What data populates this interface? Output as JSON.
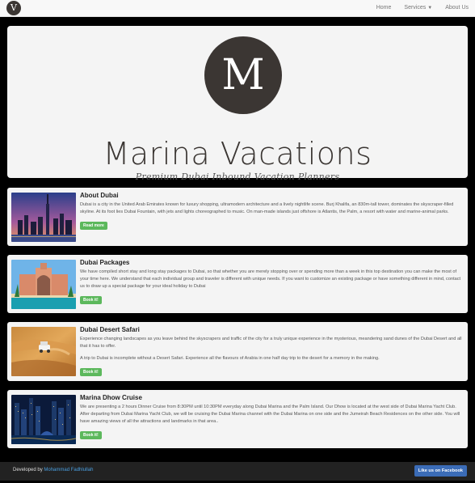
{
  "navbar": {
    "logo_letter": "V",
    "links": [
      {
        "label": "Home"
      },
      {
        "label": "Services",
        "dropdown": true
      },
      {
        "label": "About Us"
      }
    ]
  },
  "hero": {
    "logo_letter": "M",
    "title": "Marina Vacations",
    "subtitle": "Premium Dubai Inbound Vacation Planners"
  },
  "cards": [
    {
      "title": "About Dubai",
      "text": "Dubai is a city in the United Arab Emirates known for luxury shopping, ultramodern architecture and a lively nightlife scene. Burj Khalifa, an 830m-tall tower, dominates the skyscraper-filled skyline. At its foot lies Dubai Fountain, with jets and lights choreographed to music. On man-made islands just offshore is Atlantis, the Palm, a resort with water and marine-animal parks.",
      "text2": "",
      "button": "Read more"
    },
    {
      "title": "Dubai Packages",
      "text": "We have compiled short stay and long stay packages to Dubai, so that whether you are merely stopping over or spending more than a week in this top destination you can make the most of your time here. We understand that each individual group and traveler is different with unique needs. If you want to customize an existing package or have something different in mind, contact us to draw up a special package for your ideal holiday to Dubai",
      "text2": "",
      "button": "Book it!"
    },
    {
      "title": "Dubai Desert Safari",
      "text": "Experience changing landscapes as you leave behind the skyscrapers and traffic of the city for a truly unique experience in the mysterious, meandering sand dunes of the Dubai Desert and all that it has to offer.",
      "text2": "A trip to Dubai is incomplete without a Desert Safari. Experience all the flavours of Arabia in one half day trip to the desert for a memory in the making.",
      "button": "Book it!"
    },
    {
      "title": "Marina Dhow Cruise",
      "text": "We are presenting a 2 hours Dinner Cruise from 8:30PM until 10:30PM everyday along Dubai Marina and the Palm Island. Our Dhow is located at the west side of Dubai Marina Yacht Club. After departing from Dubai Marina Yacht Club, we will be cruising the Dubai Marina channel with the Dubai Marina on one side and the Jumeirah Beach Residences on the other side. You will have amazing views of all the attractions and landmarks in that area..",
      "text2": "",
      "button": "Book it!"
    }
  ],
  "footer": {
    "developed_by": "Developed by",
    "author": "Mohammad Fadhlullah",
    "facebook_button": "Like us on Facebook"
  }
}
